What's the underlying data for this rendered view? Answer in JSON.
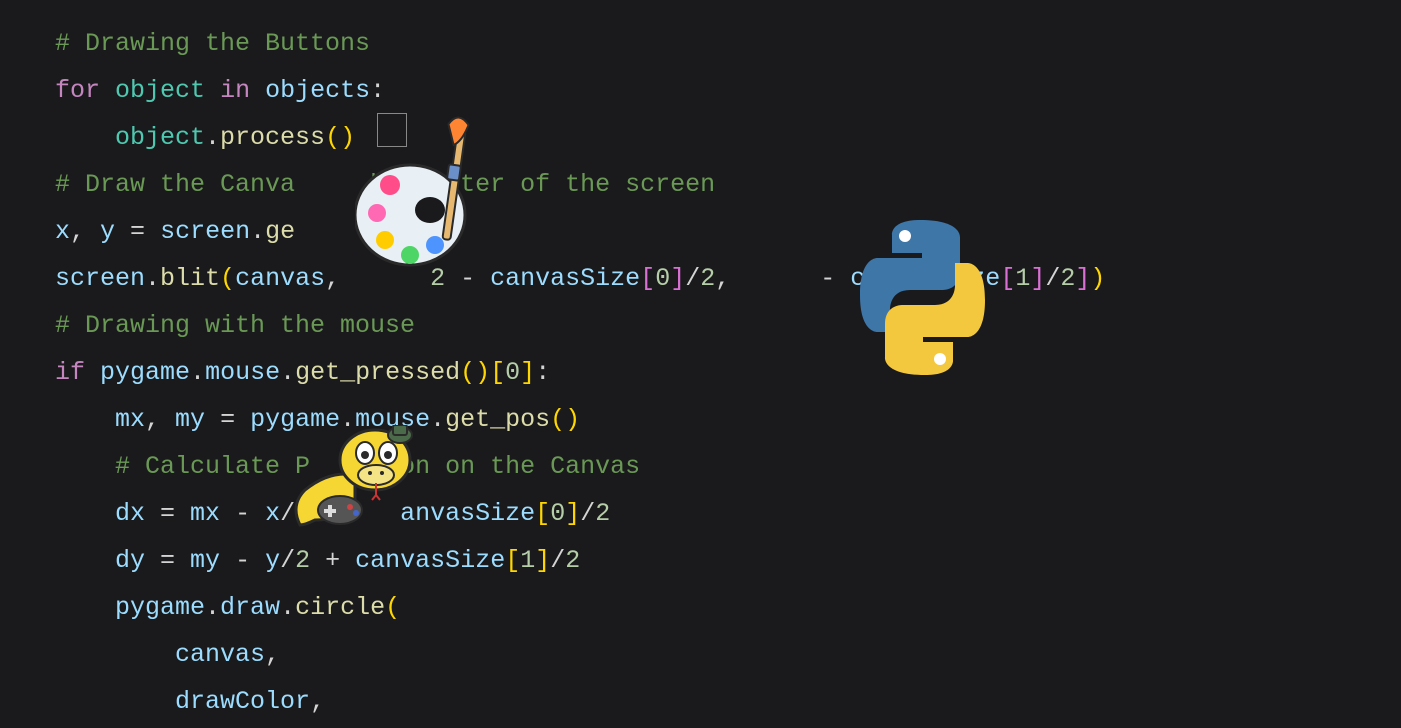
{
  "lines": {
    "l1_comment": "# Drawing the Buttons",
    "l2_for": "for",
    "l2_obj": "object",
    "l2_in": "in",
    "l2_objs": "objects",
    "l3_obj": "object",
    "l3_proc": "process",
    "l4_comment": "# Draw the Canva",
    "l4_comment_b": "he center of the screen",
    "l5_x": "x",
    "l5_y": "y",
    "l5_scr": "screen",
    "l5_ge": "ge",
    "l6_scr": "screen",
    "l6_blit": "blit",
    "l6_cv": "canvas",
    "l6_two": "2",
    "l6_cs1": "canvasSize",
    "l6_zero": "0",
    "l6_cs2": "canvasSize",
    "l6_one": "1",
    "l7_comment": "# Drawing with the mouse",
    "l8_if": "if",
    "l8_pg": "pygame",
    "l8_mouse": "mouse",
    "l8_gp": "get_pressed",
    "l8_zero": "0",
    "l9_mx": "mx",
    "l9_my": "my",
    "l9_pg": "pygame",
    "l9_mouse": "mouse",
    "l9_gps": "get_pos",
    "l10_comment": "# Calculate P",
    "l10_comment_b": "on on the Canvas",
    "l11_dx": "dx",
    "l11_mx": "mx",
    "l11_x": "x",
    "l11_two": "2",
    "l11_cs": "anvasSize",
    "l11_zero": "0",
    "l12_dy": "dy",
    "l12_my": "my",
    "l12_y": "y",
    "l12_two1": "2",
    "l12_plus": "+",
    "l12_cs": "canvasSize",
    "l12_one": "1",
    "l12_two2": "2",
    "l13_pg": "pygame",
    "l13_draw": "draw",
    "l13_circ": "circle",
    "l14_cv": "canvas",
    "l15_dc": "drawColor"
  },
  "icons": {
    "paint": "paint-palette-icon",
    "python": "python-logo-icon",
    "snake": "pygame-snake-icon"
  }
}
